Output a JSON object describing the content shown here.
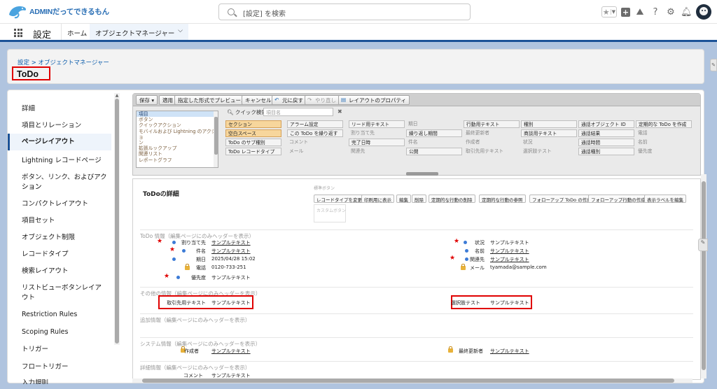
{
  "header": {
    "logo_text": "ADMINだってできるもん",
    "search_placeholder": "[設定] を検索"
  },
  "nav": {
    "app_title": "設定",
    "tabs": [
      {
        "label": "ホーム"
      },
      {
        "label": "オブジェクトマネージャー"
      }
    ]
  },
  "page": {
    "breadcrumb": "設定 > オブジェクトマネージャー",
    "title": "ToDo"
  },
  "sidebar": {
    "items": [
      "詳細",
      "項目とリレーション",
      "ページレイアウト",
      "Lightning レコードページ",
      "ボタン、リンク、およびアクション",
      "ション",
      "コンパクトレイアウト",
      "項目セット",
      "オブジェクト制限",
      "レコードタイプ",
      "検索レイアウト",
      "リストビューボタンレイア",
      "ウト",
      "Restriction Rules",
      "Scoping Rules",
      "トリガー",
      "フロートリガー",
      "入力規則"
    ],
    "active_index": 2
  },
  "toolbar": {
    "buttons": [
      "保存 ▾",
      "適用",
      "指定した形式でプレビュー... ▾",
      "キャンセル",
      "元に戻す",
      "やり直し",
      "レイアウトのプロパティ"
    ]
  },
  "palette": {
    "categories": [
      "項目",
      "ボタン",
      "クイックアクション",
      "モバイルおよび Lightning のアクショ",
      "ン",
      "拡張ルックアップ",
      "関連リスト",
      "レポートグラフ"
    ],
    "quick_search_label": "クイック検索",
    "quick_search_placeholder": "項目名",
    "grid": [
      [
        "セクション",
        "アラーム設定",
        "リード用テキスト",
        "期日",
        "行動用テキスト",
        "種別",
        "通話オブジェクト ID",
        "定期的な ToDo を作成"
      ],
      [
        "空白スペース",
        "この ToDo を繰り返す",
        "割り当て先",
        "繰り返し期間",
        "最終更新者",
        "商談用テキスト",
        "通話結果",
        "電話"
      ],
      [
        "ToDo のサブ種別",
        "コメント",
        "完了日時",
        "件名",
        "作成者",
        "状況",
        "通話時間",
        "名前"
      ],
      [
        "ToDo レコードタイプ",
        "メール",
        "関連先",
        "公開",
        "取引先用テキスト",
        "選択肢テスト",
        "通話種別",
        "優先度"
      ]
    ]
  },
  "canvas": {
    "detail_title": "ToDoの詳細",
    "standard_buttons_label": "標準ボタン",
    "buttons": [
      "レコードタイプを変更",
      "印刷用に表示",
      "編集",
      "削除",
      "定期的な行動の削除",
      "定期的な行動の参照",
      "フォローアップ ToDo の作成",
      "フォローアップ行動の作成",
      "表示ラベルを編集"
    ],
    "custom_buttons_label": "カスタムボタン",
    "sections": {
      "info": "ToDo 情報（編集ページにのみヘッダーを表示）",
      "other": "その他の情報（編集ページにのみヘッダーを表示）",
      "add": "追加情報（編集ページにのみヘッダーを表示）",
      "system": "システム情報（編集ページにのみヘッダーを表示）",
      "detail": "詳細情報（編集ページにのみヘッダーを表示）"
    },
    "left_fields": [
      {
        "label": "割り当て先",
        "value": "サンプルテキスト"
      },
      {
        "label": "件名",
        "value": "サンプルテキスト"
      },
      {
        "label": "期日",
        "value": "2025/04/28 15:02"
      },
      {
        "label": "電話",
        "value": "0120-733-251"
      },
      {
        "label": "優先度",
        "value": "サンプルテキスト"
      }
    ],
    "right_fields": [
      {
        "label": "状況",
        "value": "サンプルテキスト"
      },
      {
        "label": "名前",
        "value": "サンプルテキスト"
      },
      {
        "label": "関連先",
        "value": "サンプルテキスト"
      },
      {
        "label": "メール",
        "value": "tyamada@sample.com"
      }
    ],
    "other_left": {
      "label": "取引先用テキスト",
      "value": "サンプルテキスト"
    },
    "other_right": {
      "label": "選択肢テスト",
      "value": "サンプルテキスト"
    },
    "system_left": {
      "label": "作成者",
      "value": "サンプルテキスト"
    },
    "system_right": {
      "label": "最終更新者",
      "value": "サンプルテキスト"
    },
    "detail_field": {
      "label": "コメント",
      "value": "サンプルテキスト"
    }
  },
  "colors": {
    "accent": "#1b5297",
    "highlight": "#e00000"
  }
}
